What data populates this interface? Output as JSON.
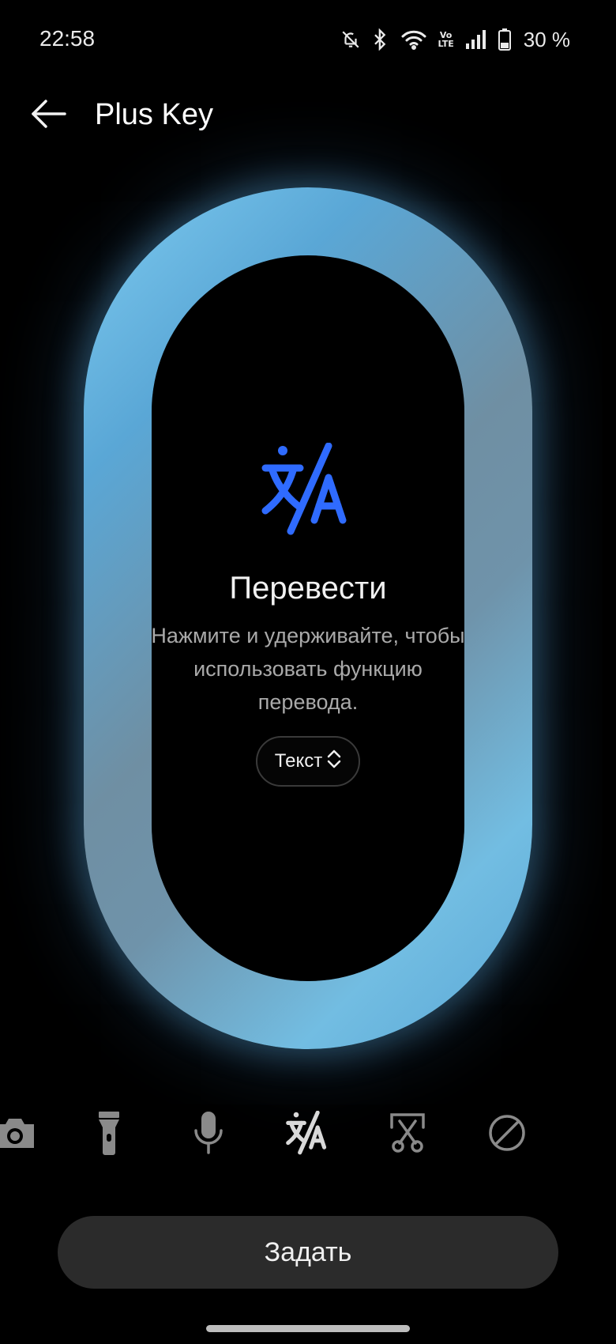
{
  "status_bar": {
    "time": "22:58",
    "volte_top": "Vo",
    "volte_bottom": "LTE",
    "battery_percent": "30 %",
    "icons": [
      "mute-bell-icon",
      "bluetooth-icon",
      "wifi-icon",
      "volte-icon",
      "signal-icon",
      "battery-icon"
    ]
  },
  "header": {
    "title": "Plus Key",
    "back_icon": "arrow-left-icon"
  },
  "feature": {
    "icon": "translate-icon",
    "title": "Перевести",
    "description": "Нажмите и удерживайте, чтобы использовать функцию перевода.",
    "mode_label": "Текст",
    "mode_icon": "chevron-up-down-icon"
  },
  "tools": [
    {
      "name": "camera",
      "icon": "camera-icon"
    },
    {
      "name": "flashlight",
      "icon": "flashlight-icon"
    },
    {
      "name": "voice-recorder",
      "icon": "microphone-icon"
    },
    {
      "name": "translate",
      "icon": "translate-icon",
      "selected": true
    },
    {
      "name": "screenshot",
      "icon": "screenshot-scissors-icon"
    },
    {
      "name": "none",
      "icon": "prohibited-icon"
    }
  ],
  "actions": {
    "set_label": "Задать"
  },
  "colors": {
    "accent_blue": "#2f6bff",
    "ring_light": "#7ecbf0",
    "ring_mid": "#6f8fa3",
    "button_bg": "#2b2b2b"
  }
}
